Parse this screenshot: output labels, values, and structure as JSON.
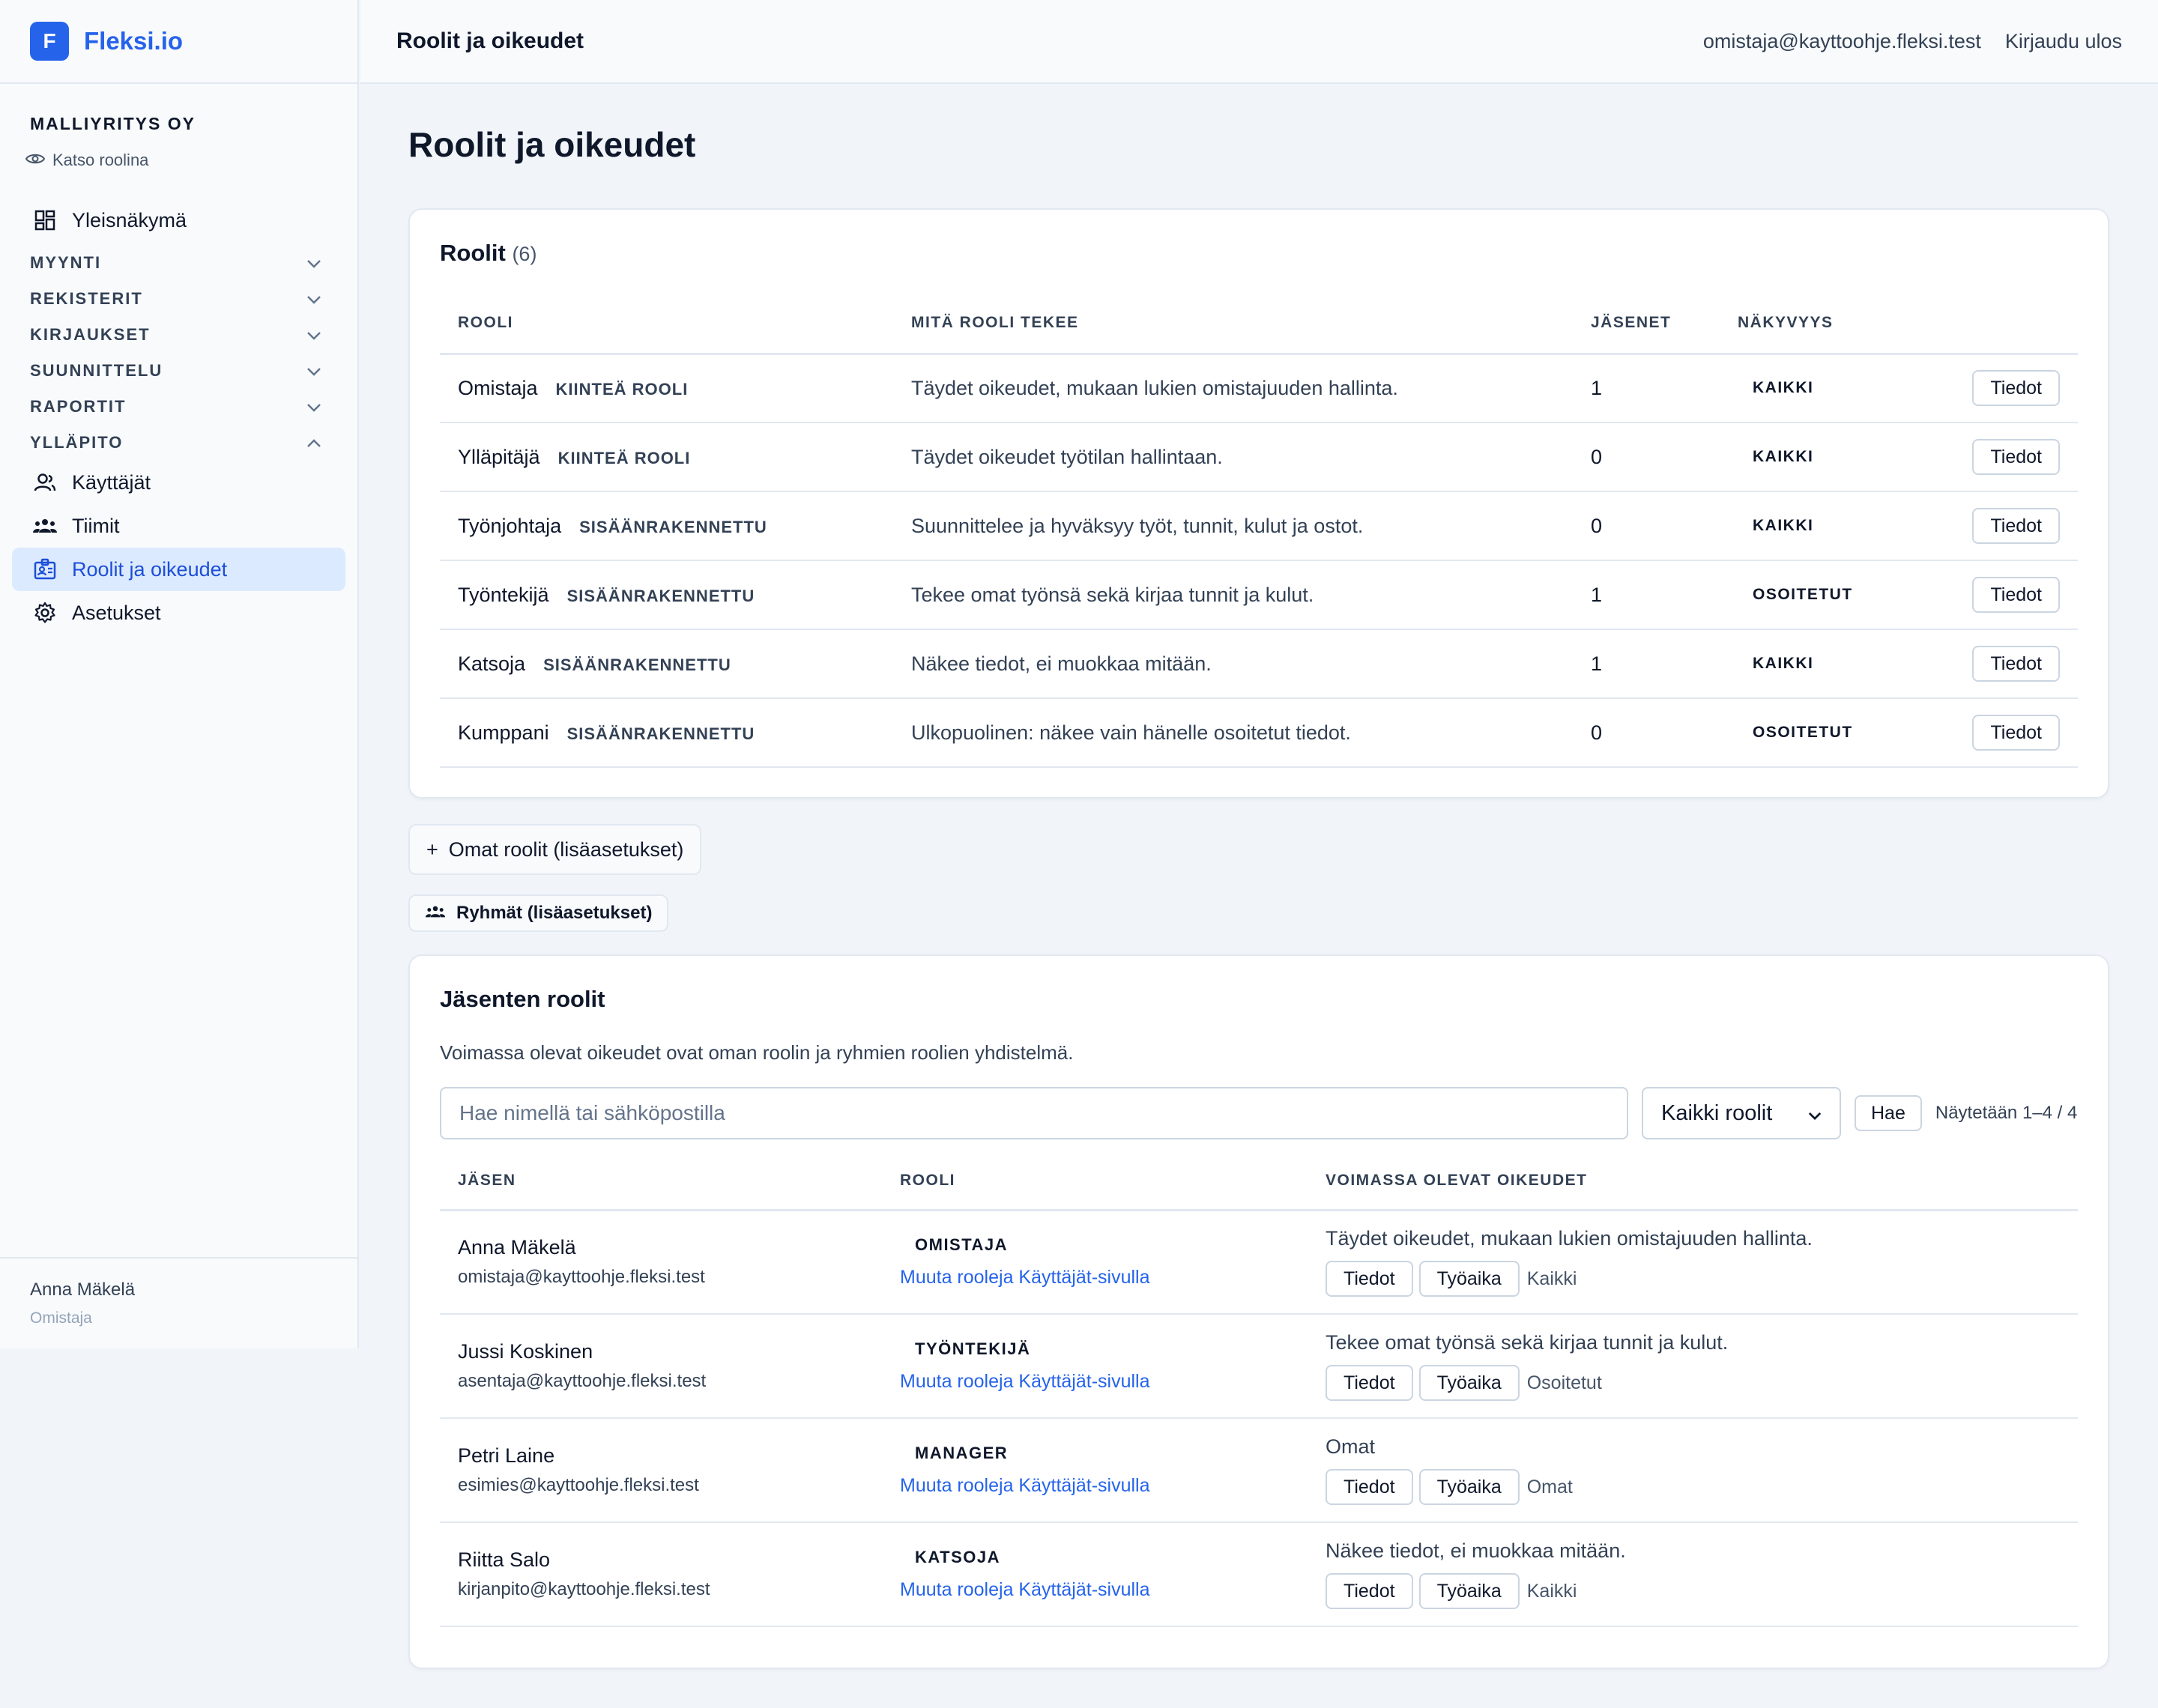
{
  "brand": {
    "logo_letter": "F",
    "name": "Fleksi.io"
  },
  "sidebar": {
    "company": "MALLIYRITYS OY",
    "view_as": "Katso roolina",
    "overview": "Yleisnäkymä",
    "sections": [
      "MYYNTI",
      "REKISTERIT",
      "KIRJAUKSET",
      "SUUNNITTELU",
      "RAPORTIT",
      "YLLÄPITO"
    ],
    "admin_items": [
      "Käyttäjät",
      "Tiimit",
      "Roolit ja oikeudet",
      "Asetukset"
    ],
    "user_name": "Anna Mäkelä",
    "user_role": "Omistaja"
  },
  "topbar": {
    "title": "Roolit ja oikeudet",
    "email": "omistaja@kayttoohje.fleksi.test",
    "logout": "Kirjaudu ulos"
  },
  "page": {
    "title": "Roolit ja oikeudet"
  },
  "roles": {
    "title": "Roolit",
    "count": "(6)",
    "headers": [
      "ROOLI",
      "MITÄ ROOLI TEKEE",
      "JÄSENET",
      "NÄKYVYYS"
    ],
    "details_label": "Tiedot",
    "rows": [
      {
        "name": "Omistaja",
        "tag": "KIINTEÄ ROOLI",
        "desc": "Täydet oikeudet, mukaan lukien omistajuuden hallinta.",
        "members": "1",
        "visibility": "KAIKKI"
      },
      {
        "name": "Ylläpitäjä",
        "tag": "KIINTEÄ ROOLI",
        "desc": "Täydet oikeudet työtilan hallintaan.",
        "members": "0",
        "visibility": "KAIKKI"
      },
      {
        "name": "Työnjohtaja",
        "tag": "SISÄÄNRAKENNETTU",
        "desc": "Suunnittelee ja hyväksyy työt, tunnit, kulut ja ostot.",
        "members": "0",
        "visibility": "KAIKKI"
      },
      {
        "name": "Työntekijä",
        "tag": "SISÄÄNRAKENNETTU",
        "desc": "Tekee omat työnsä sekä kirjaa tunnit ja kulut.",
        "members": "1",
        "visibility": "OSOITETUT"
      },
      {
        "name": "Katsoja",
        "tag": "SISÄÄNRAKENNETTU",
        "desc": "Näkee tiedot, ei muokkaa mitään.",
        "members": "1",
        "visibility": "KAIKKI"
      },
      {
        "name": "Kumppani",
        "tag": "SISÄÄNRAKENNETTU",
        "desc": "Ulkopuolinen: näkee vain hänelle osoitetut tiedot.",
        "members": "0",
        "visibility": "OSOITETUT"
      }
    ]
  },
  "advanced": {
    "custom_roles": "Omat roolit (lisäasetukset)",
    "groups": "Ryhmät (lisäasetukset)"
  },
  "members": {
    "title": "Jäsenten roolit",
    "description": "Voimassa olevat oikeudet ovat oman roolin ja ryhmien roolien yhdistelmä.",
    "search_placeholder": "Hae nimellä tai sähköpostilla",
    "role_filter": "Kaikki roolit",
    "search_button": "Hae",
    "shown": "Näytetään 1–4 / 4",
    "headers": [
      "JÄSEN",
      "ROOLI",
      "VOIMASSA OLEVAT OIKEUDET"
    ],
    "change_link": "Muuta rooleja Käyttäjät-sivulla",
    "details_label": "Tiedot",
    "worktime_label": "Työaika",
    "rows": [
      {
        "name": "Anna Mäkelä",
        "email": "omistaja@kayttoohje.fleksi.test",
        "role": "OMISTAJA",
        "permissions": "Täydet oikeudet, mukaan lukien omistajuuden hallinta.",
        "scope": "Kaikki"
      },
      {
        "name": "Jussi Koskinen",
        "email": "asentaja@kayttoohje.fleksi.test",
        "role": "TYÖNTEKIJÄ",
        "permissions": "Tekee omat työnsä sekä kirjaa tunnit ja kulut.",
        "scope": "Osoitetut"
      },
      {
        "name": "Petri Laine",
        "email": "esimies@kayttoohje.fleksi.test",
        "role": "MANAGER",
        "permissions": "Omat",
        "scope": "Omat"
      },
      {
        "name": "Riitta Salo",
        "email": "kirjanpito@kayttoohje.fleksi.test",
        "role": "KATSOJA",
        "permissions": "Näkee tiedot, ei muokkaa mitään.",
        "scope": "Kaikki"
      }
    ]
  },
  "colors": {
    "accent": "#2563eb",
    "active_bg": "#dbeafe",
    "border": "#e2e8f0"
  }
}
